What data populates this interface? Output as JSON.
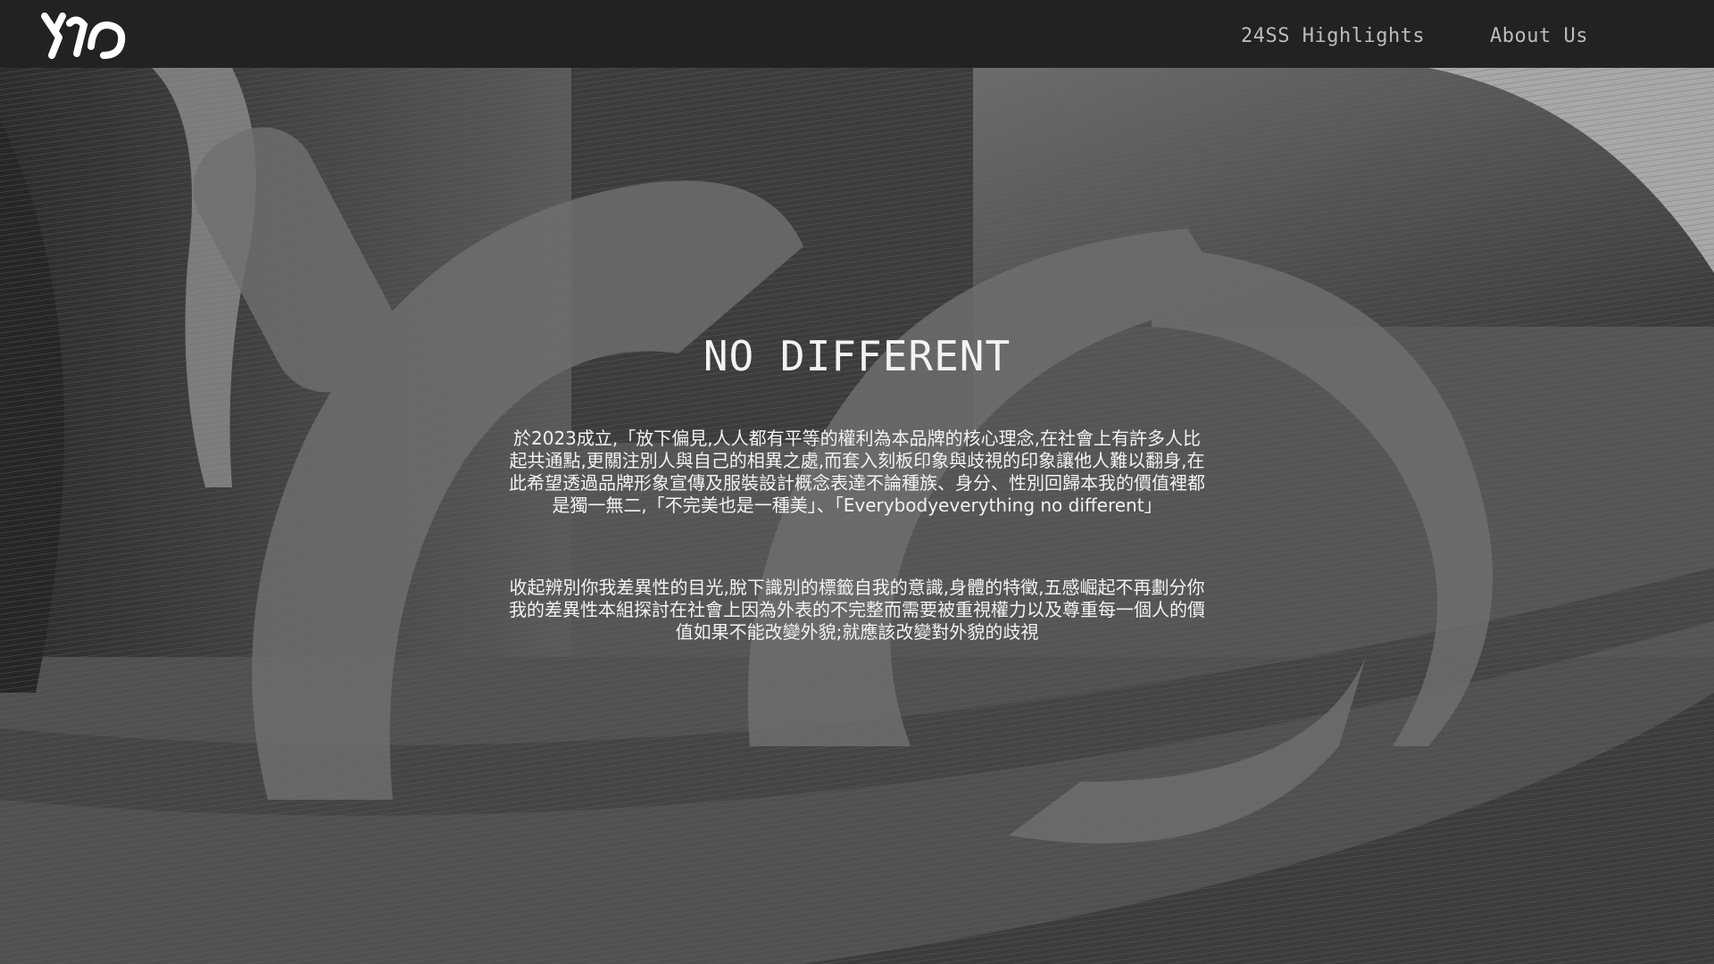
{
  "nav": {
    "logo_name": "brand-logo",
    "links": [
      {
        "label": "24SS Highlights"
      },
      {
        "label": "About Us"
      }
    ]
  },
  "hero": {
    "title": "NO DIFFERENT",
    "paragraph1": "於2023成立,「放下偏見,人人都有平等的權利為本品牌的核心理念,在社會上有許多人比起共通點,更關注別人與自己的相異之處,而套入刻板印象與歧視的印象讓他人難以翻身,在此希望透過品牌形象宣傳及服裝設計概念表達不論種族、身分、性別回歸本我的價值裡都是獨一無二,「不完美也是一種美」、「Everybodyeverything no different」",
    "paragraph2": "收起辨別你我差異性的目光,脫下識別的標籤自我的意識,身體的特徵,五感崛起不再劃分你我的差異性本組探討在社會上因為外表的不完整而需要被重視權力以及尊重每一個人的價值如果不能改變外貌;就應該改變對外貌的歧視"
  },
  "colors": {
    "navbar": "#222222",
    "text": "#f2f2f2",
    "nav_text": "#bcbcbc"
  }
}
